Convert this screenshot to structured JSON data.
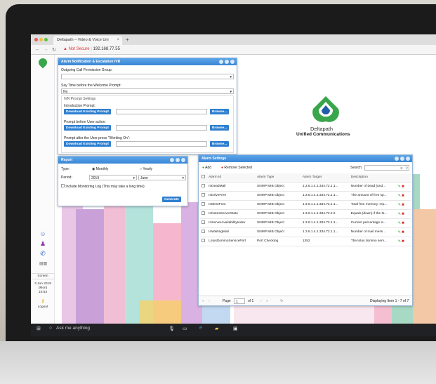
{
  "browser": {
    "tab_title": "Deltapath – Video & Voice Uni",
    "url_security": "Not Secure",
    "url": "192.168.77.55"
  },
  "sidebar": {
    "screen_label": "Screen",
    "date": "3 Jun 2019",
    "day": "(Mon)",
    "time": "10:53",
    "logout_label": "Logout"
  },
  "brand": {
    "name": "Deltapath",
    "tagline": "Unified Communications"
  },
  "ivr_window": {
    "title": "Alarm Notification & Escalation IVR",
    "outgoing_label": "Outgoing Call Permission Group:",
    "say_time_label": "Say Time before the Welcome Prompt:",
    "say_time_value": "No",
    "prompt_settings_label": "IVR Prompt Settings",
    "intro_label": "Introduction Prompt:",
    "before_user_label": "Prompt before User action:",
    "working_label": "Prompt after the User press \"Working On\":",
    "download_label": "Download Existing Prompt",
    "browse_label": "Browse..."
  },
  "report_window": {
    "title": "Report",
    "type_label": "Type:",
    "monthly_label": "Monthly",
    "yearly_label": "Yearly",
    "period_label": "Period:",
    "year_value": "2019",
    "month_value": "June",
    "include_label": "Include Monitoring Log (This may take a long time)",
    "generate_label": "Generate"
  },
  "alarm_window": {
    "title": "Alarm Settings",
    "add_label": "Add",
    "remove_label": "Remove Selected",
    "search_label": "Search:",
    "columns": [
      "Alarm Id",
      "Alarm Type",
      "Alarm Target",
      "Description"
    ],
    "rows": [
      [
        "InDeadMail",
        "SNMP MIB Object",
        "1.3.6.1.4.1.334.72.1.1...",
        "Number of dead (und..."
      ],
      [
        "InDriveFree",
        "SNMP MIB Object",
        "1.3.6.1.4.1.334.72.1.1...",
        "The amount of free sp..."
      ],
      [
        "InMemFree",
        "SNMP MIB Object",
        "1.3.6.1.4.1.334.72.1.1...",
        "Total free memory, rep..."
      ],
      [
        "InNotesServerState",
        "SNMP MIB Object",
        "1.3.6.1.4.1.334.72.2.2",
        "Equals (down) if the N..."
      ],
      [
        "InServerAvailabilityIndex",
        "SNMP MIB Object",
        "1.3.6.1.4.1.334.72.1.1...",
        "Current percentage in..."
      ],
      [
        "InWaitingMail",
        "SNMP MIB Object",
        "1.3.6.1.4.1.334.72.1.1...",
        "Number of mail mess..."
      ],
      [
        "LotusDominoServicePort",
        "Port Checking",
        "1352",
        "The lotus domino serv..."
      ]
    ],
    "page_label": "Page",
    "page_value": "1",
    "of_label": "of 1",
    "displaying": "Displaying Item 1 - 7 of 7"
  },
  "taskbar": {
    "search_placeholder": "Ask me anything"
  },
  "colors": {
    "accent": "#3a86d6",
    "brand_green": "#3aa64b",
    "danger": "#d22222"
  }
}
